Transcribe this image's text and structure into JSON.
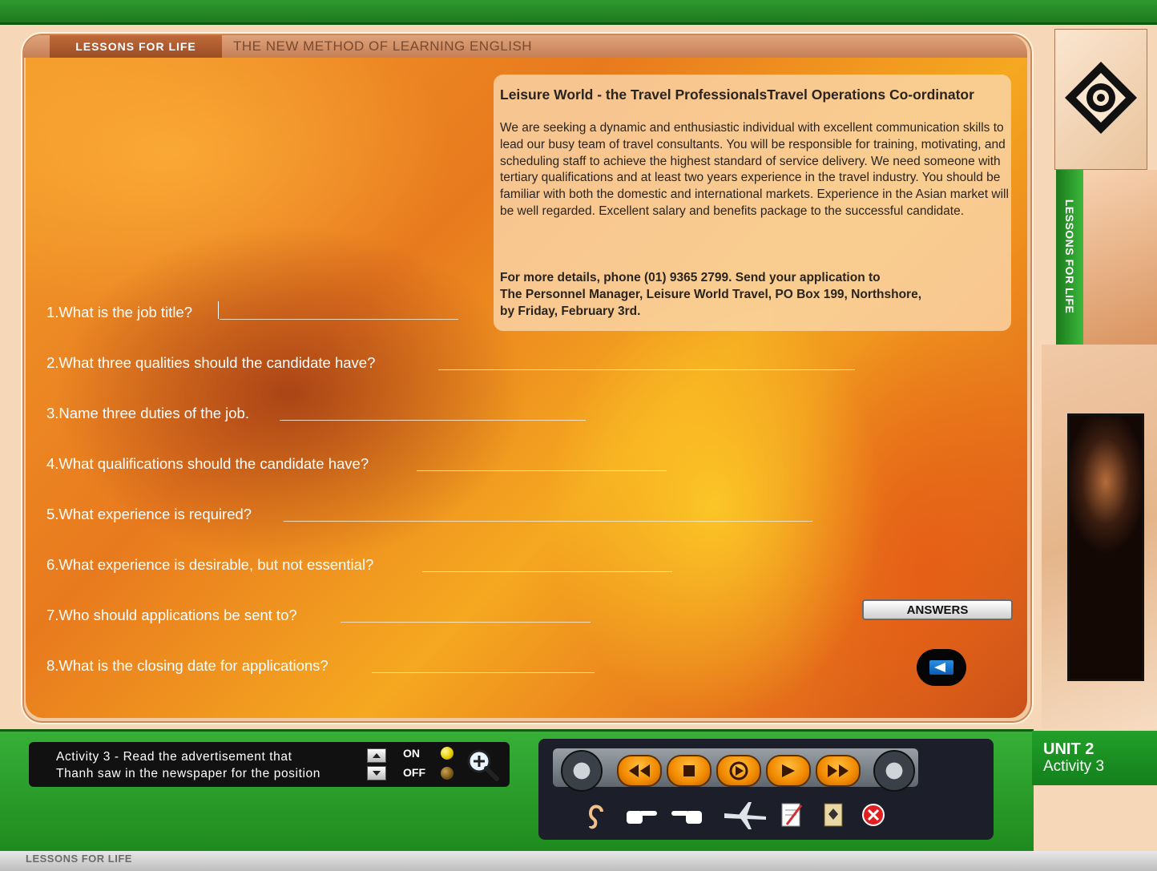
{
  "header": {
    "brand_tag": "LESSONS FOR LIFE",
    "subtitle": "THE NEW METHOD OF LEARNING ENGLISH"
  },
  "advert": {
    "title": "Leisure World - the Travel ProfessionalsTravel Operations Co-ordinator",
    "body": "We are seeking a dynamic and enthusiastic individual with excellent communication skills to lead our busy team of travel consultants. You will be responsible for training, motivating, and scheduling staff to achieve the highest standard of service delivery. We need someone with tertiary qualifications and at least two years experience in the travel industry. You should be familiar with both the domestic and international markets. Experience in the Asian market will be well regarded. Excellent salary and benefits package to the successful candidate.",
    "contact_line1": "For more details, phone (01) 9365 2799. Send your application to",
    "contact_line2": "The Personnel Manager, Leisure World Travel, PO Box 199, Northshore,",
    "contact_line3": "by Friday, February 3rd."
  },
  "questions": [
    {
      "text": "1.What is the job title?",
      "answer": ""
    },
    {
      "text": "2.What three qualities should the candidate have?",
      "answer": ""
    },
    {
      "text": "3.Name three duties of the job.",
      "answer": ""
    },
    {
      "text": "4.What qualifications should the candidate have?",
      "answer": ""
    },
    {
      "text": "5.What experience is required?",
      "answer": ""
    },
    {
      "text": "6.What experience is desirable, but not essential?",
      "answer": ""
    },
    {
      "text": "7.Who should applications be sent to?",
      "answer": ""
    },
    {
      "text": "8.What is the closing date for applications?",
      "answer": ""
    }
  ],
  "buttons": {
    "answers_label": "ANSWERS",
    "back_icon": "back-arrow-icon"
  },
  "sidebar": {
    "vertical_label": "LESSONS FOR LIFE",
    "logo_icon": "diamond-eye-logo"
  },
  "bottom": {
    "activity_line1": "Activity 3 - Read the advertisement that",
    "activity_line2": "Thanh saw in the newspaper for the position",
    "on_label": "ON",
    "off_label": "OFF",
    "zoom_icon": "zoom-in-icon",
    "media_controls": [
      "rewind-icon",
      "stop-icon",
      "replay-icon",
      "play-icon",
      "fast-forward-icon"
    ],
    "tools": [
      "ear-icon",
      "hand-right-icon",
      "hand-left-icon",
      "airplane-icon",
      "notepad-icon",
      "scroll-icon",
      "close-icon"
    ],
    "footer_label": "LESSONS FOR LIFE"
  },
  "unit": {
    "title": "UNIT 2",
    "subtitle": "Activity 3"
  },
  "colors": {
    "accent_green": "#1e8a1e",
    "content_orange": "#e87a1e",
    "media_orange": "#f28a00"
  }
}
